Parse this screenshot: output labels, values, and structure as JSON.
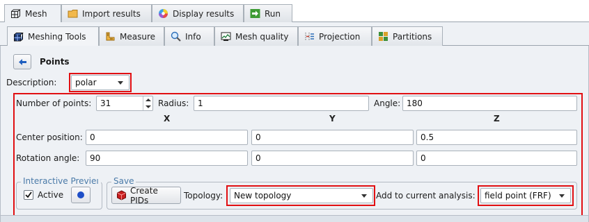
{
  "top_tabs": [
    {
      "label": "Mesh",
      "icon": "mesh-icon"
    },
    {
      "label": "Import results",
      "icon": "folder-icon"
    },
    {
      "label": "Display results",
      "icon": "color-wheel-icon"
    },
    {
      "label": "Run",
      "icon": "run-arrow-icon"
    }
  ],
  "sub_tabs": [
    {
      "label": "Meshing Tools",
      "icon": "meshing-tools-icon"
    },
    {
      "label": "Measure",
      "icon": "measure-icon"
    },
    {
      "label": "Info",
      "icon": "info-magnifier-icon"
    },
    {
      "label": "Mesh quality",
      "icon": "mesh-quality-icon"
    },
    {
      "label": "Projection",
      "icon": "projection-icon"
    },
    {
      "label": "Partitions",
      "icon": "partitions-icon"
    }
  ],
  "header": {
    "title": "Points",
    "back_icon": "back-arrow-icon"
  },
  "description": {
    "label": "Description:",
    "value": "polar"
  },
  "points": {
    "num_label": "Number of points:",
    "num_value": "31",
    "radius_label": "Radius:",
    "radius_value": "1",
    "angle_label": "Angle:",
    "angle_value": "180"
  },
  "axes": {
    "x": "X",
    "y": "Y",
    "z": "Z"
  },
  "center": {
    "label": "Center position:",
    "x": "0",
    "y": "0",
    "z": "0.5"
  },
  "rotation": {
    "label": "Rotation angle:",
    "x": "90",
    "y": "0",
    "z": "0"
  },
  "interactive": {
    "title": "Interactive Previeı",
    "active_label": "Active",
    "checked": true
  },
  "save": {
    "title": "Save",
    "create_label": "Create PIDs",
    "topology_label": "Topology:",
    "topology_value": "New topology",
    "analysis_label": "Add to current analysis:",
    "analysis_value": "field point (FRF)"
  },
  "colors": {
    "highlight": "#e10f12",
    "accent_blue": "#1f5fbf",
    "group_title": "#4a7aa8"
  }
}
